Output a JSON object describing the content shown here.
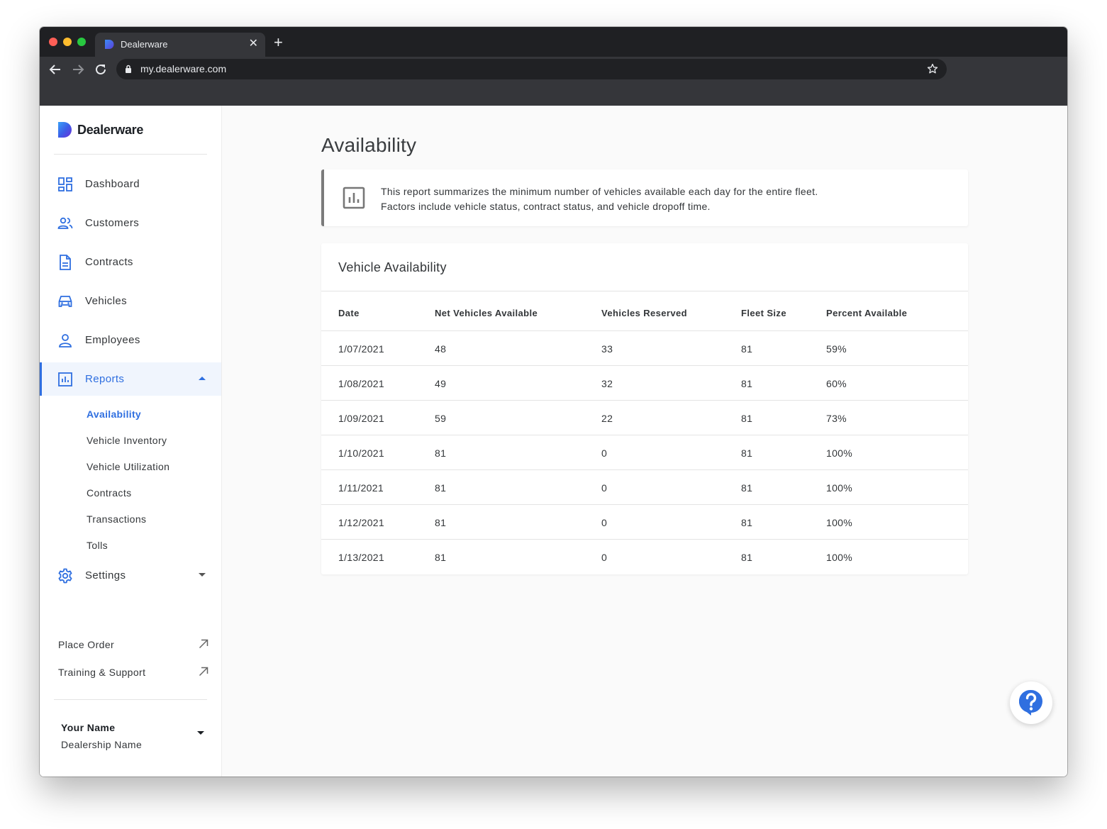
{
  "browser": {
    "tab_title": "Dealerware",
    "tab_close": "✕",
    "new_tab": "+",
    "url": "my.dealerware.com"
  },
  "brand": {
    "name": "Dealerware",
    "accent": "#2f6fe0"
  },
  "sidebar": {
    "items": [
      {
        "label": "Dashboard",
        "icon": "dashboard-icon"
      },
      {
        "label": "Customers",
        "icon": "customers-icon"
      },
      {
        "label": "Contracts",
        "icon": "document-icon"
      },
      {
        "label": "Vehicles",
        "icon": "car-icon"
      },
      {
        "label": "Employees",
        "icon": "person-icon"
      },
      {
        "label": "Reports",
        "icon": "bar-chart-icon",
        "expanded": true
      },
      {
        "label": "Settings",
        "icon": "gear-icon",
        "expanded": false
      }
    ],
    "report_subitems": [
      {
        "label": "Availability",
        "active": true
      },
      {
        "label": "Vehicle Inventory"
      },
      {
        "label": "Vehicle Utilization"
      },
      {
        "label": "Contracts"
      },
      {
        "label": "Transactions"
      },
      {
        "label": "Tolls"
      }
    ],
    "links": [
      {
        "label": "Place Order",
        "icon": "external-arrow-icon"
      },
      {
        "label": "Training & Support",
        "icon": "external-arrow-icon"
      }
    ],
    "user": {
      "name": "Your Name",
      "dealership": "Dealership Name"
    }
  },
  "main": {
    "title": "Availability",
    "info": {
      "line1": "This report summarizes the minimum number of vehicles available each day for the entire fleet.",
      "line2": "Factors include vehicle status, contract status, and vehicle dropoff time."
    },
    "table": {
      "title": "Vehicle Availability",
      "columns": [
        "Date",
        "Net Vehicles Available",
        "Vehicles Reserved",
        "Fleet Size",
        "Percent Available"
      ],
      "rows": [
        [
          "1/07/2021",
          "48",
          "33",
          "81",
          "59%"
        ],
        [
          "1/08/2021",
          "49",
          "32",
          "81",
          "60%"
        ],
        [
          "1/09/2021",
          "59",
          "22",
          "81",
          "73%"
        ],
        [
          "1/10/2021",
          "81",
          "0",
          "81",
          "100%"
        ],
        [
          "1/11/2021",
          "81",
          "0",
          "81",
          "100%"
        ],
        [
          "1/12/2021",
          "81",
          "0",
          "81",
          "100%"
        ],
        [
          "1/13/2021",
          "81",
          "0",
          "81",
          "100%"
        ]
      ]
    }
  },
  "help": {
    "icon": "help-icon",
    "color": "#2f6fe0"
  }
}
